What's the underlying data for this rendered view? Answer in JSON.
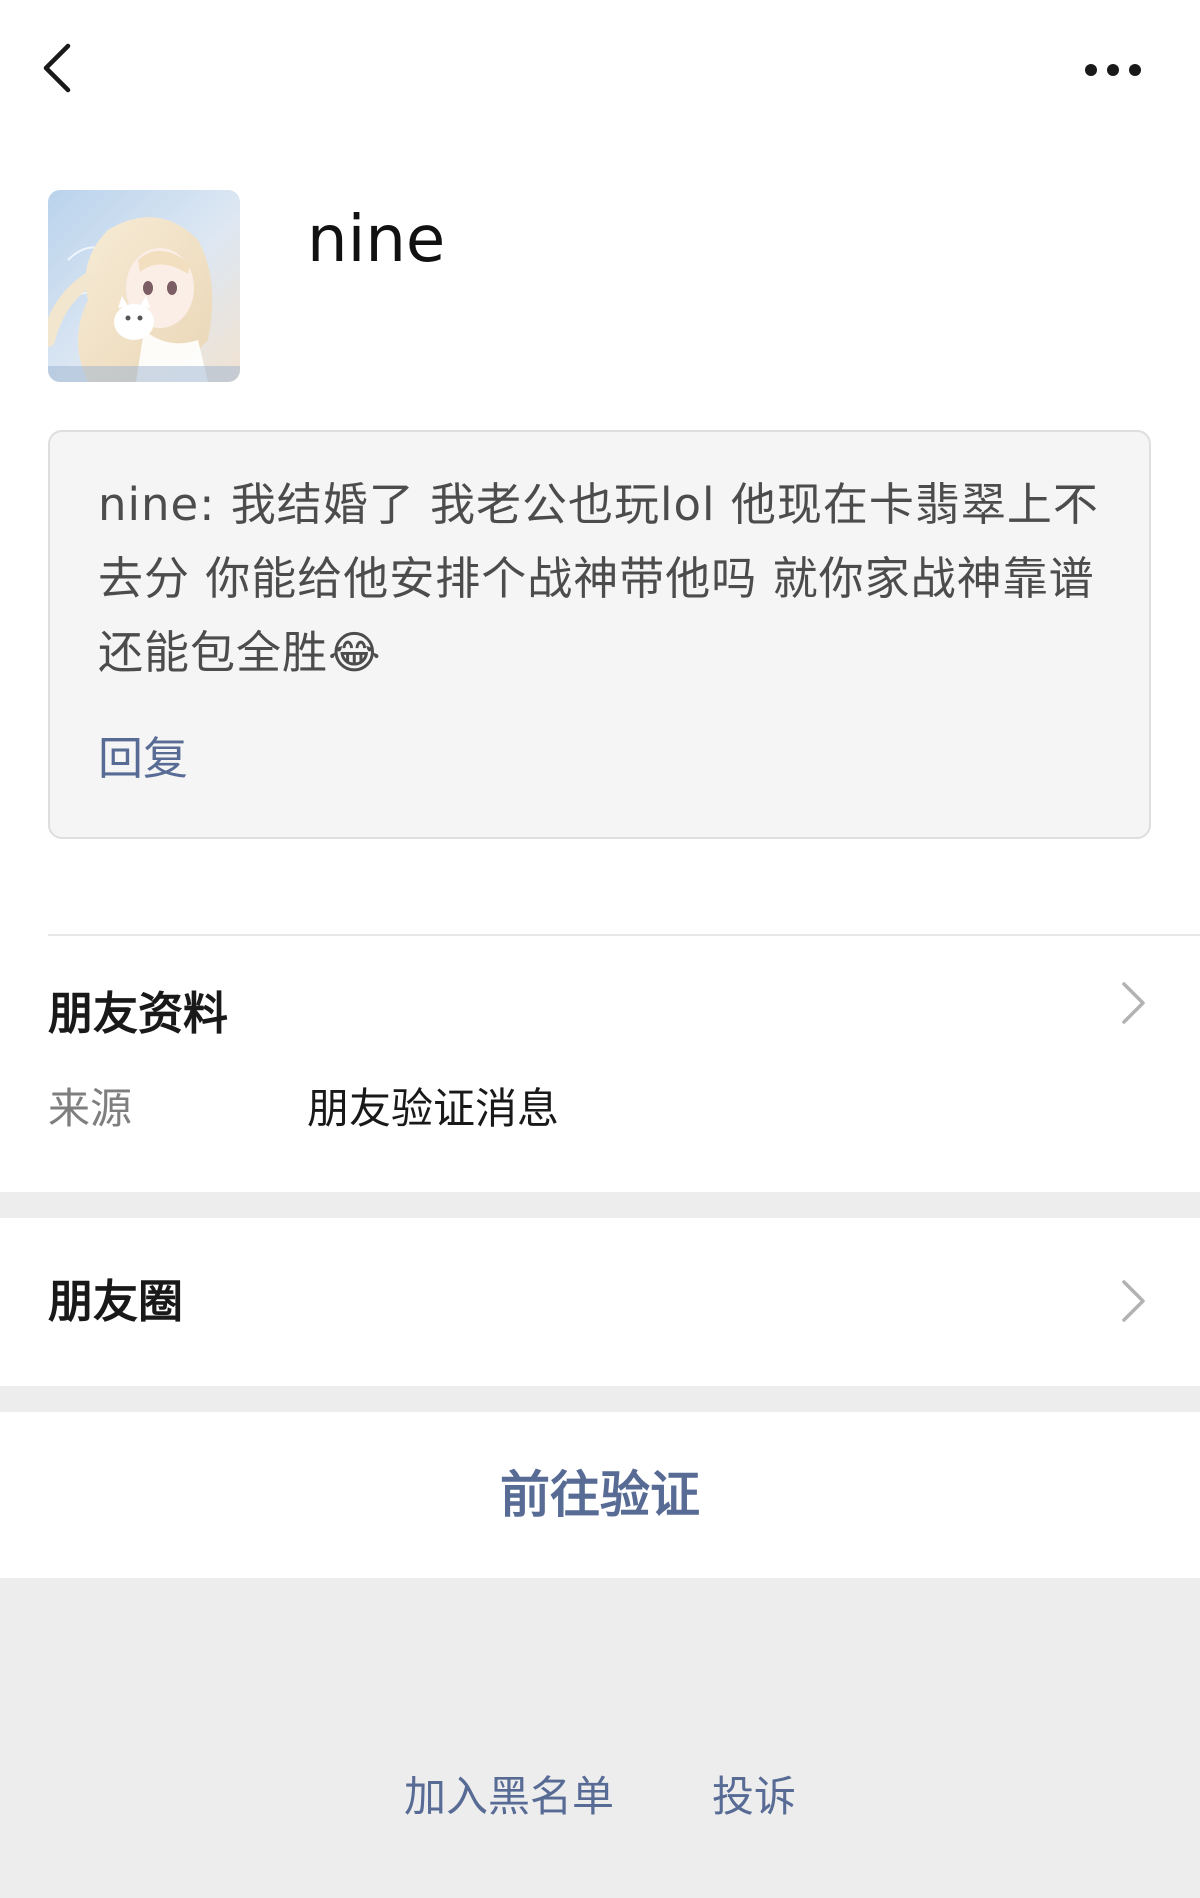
{
  "header": {
    "back_icon": "chevron-left-icon",
    "more_icon": "more-dots-icon"
  },
  "profile": {
    "name": "nine",
    "avatar": "anime-girl-avatar"
  },
  "message": {
    "text": "nine: 我结婚了 我老公也玩lol 他现在卡翡翠上不去分 你能给他安排个战神带他吗 就你家战神靠谱还能包全胜😂",
    "reply_label": "回复"
  },
  "friend_info": {
    "title": "朋友资料",
    "source_label": "来源",
    "source_value": "朋友验证消息"
  },
  "moments": {
    "title": "朋友圈"
  },
  "actions": {
    "verify_label": "前往验证",
    "blacklist_label": "加入黑名单",
    "report_label": "投诉"
  },
  "colors": {
    "link": "#576b95",
    "page_bg": "#ededed",
    "card_bg": "#f5f5f5"
  }
}
